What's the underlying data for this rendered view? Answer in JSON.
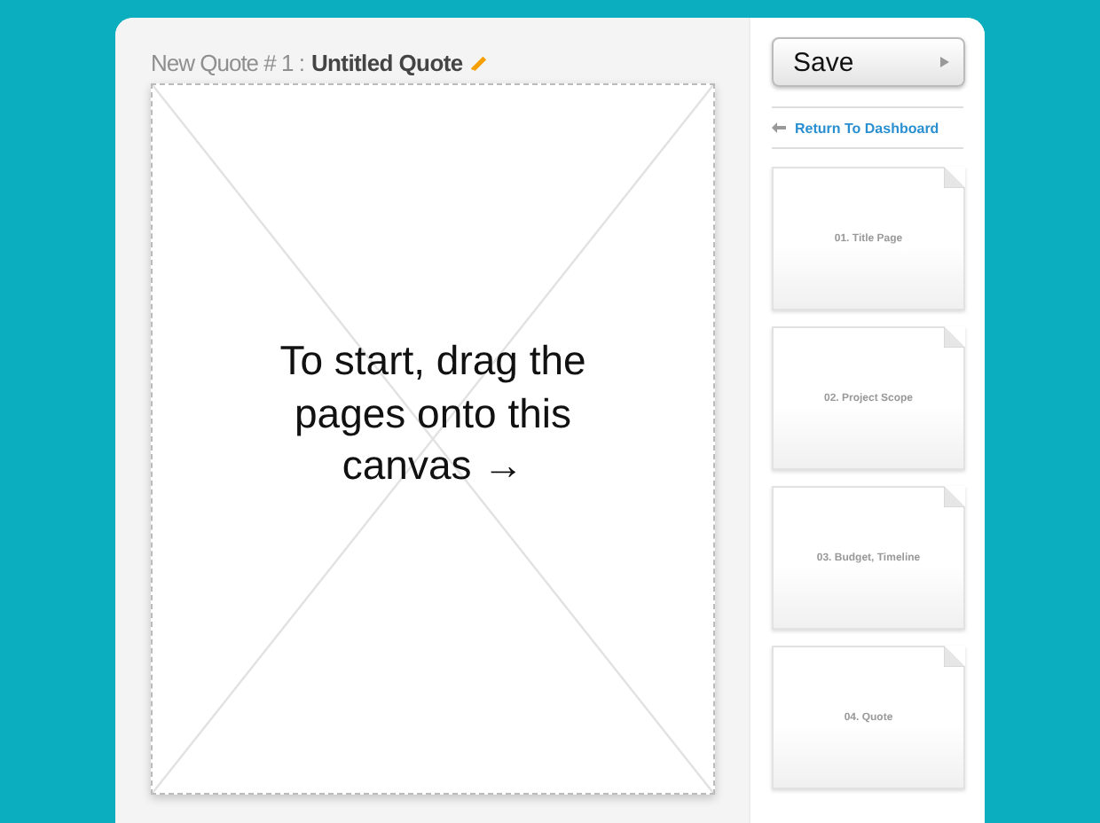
{
  "header": {
    "quote_number": "New Quote # 1 :",
    "quote_title": "Untitled Quote"
  },
  "canvas": {
    "message": "To start, drag the pages onto this canvas →"
  },
  "sidebar": {
    "save_button": "Save",
    "back_link": "Return To Dashboard",
    "pages": [
      {
        "label": "01. Title Page"
      },
      {
        "label": "02. Project Scope"
      },
      {
        "label": "03. Budget, Timeline"
      },
      {
        "label": "04. Quote"
      }
    ]
  }
}
